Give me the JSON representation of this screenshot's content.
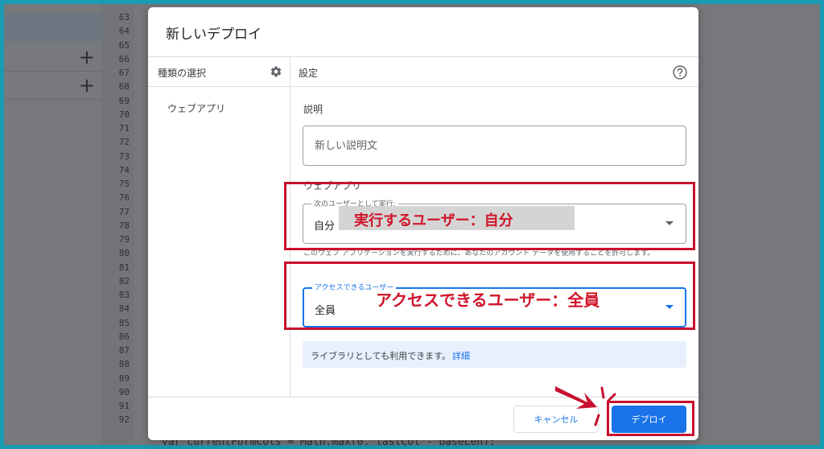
{
  "background": {
    "line_numbers": [
      "63",
      "64",
      "65",
      "66",
      "67",
      "68",
      "69",
      "70",
      "71",
      "72",
      "73",
      "74",
      "75",
      "76",
      "77",
      "78",
      "79",
      "80",
      "81",
      "82",
      "83",
      "84",
      "85",
      "86",
      "87",
      "88",
      "89",
      "90",
      "91",
      "92"
    ],
    "code_snippet": "var currentFormCols = Math.max(0, lastCol - baseLen);"
  },
  "dialog": {
    "title": "新しいデプロイ",
    "left_panel": {
      "header": "種類の選択",
      "items": [
        "ウェブアプリ"
      ]
    },
    "right_panel": {
      "header": "設定",
      "description_label": "説明",
      "description_placeholder": "新しい説明文",
      "webapp_section_label": "ウェブアプリ",
      "execute_as": {
        "legend": "次のユーザーとして実行:",
        "value": "自分"
      },
      "execute_help": "このウェブ アプリケーションを実行するために、あなたのアカウント データを使用することを許可します。",
      "who_has_access": {
        "legend": "アクセスできるユーザー",
        "value": "全員"
      },
      "library_info": "ライブラリとしても利用できます。",
      "library_link": "詳細"
    },
    "buttons": {
      "cancel": "キャンセル",
      "deploy": "デプロイ"
    }
  },
  "annotations": {
    "execute_note": "実行するユーザー：自分",
    "access_note": "アクセスできるユーザー：全員",
    "color": "#c8102e"
  },
  "colors": {
    "accent": "#1a73e8",
    "frame": "#1a9ab3",
    "info_bg": "#e8f0fe"
  }
}
